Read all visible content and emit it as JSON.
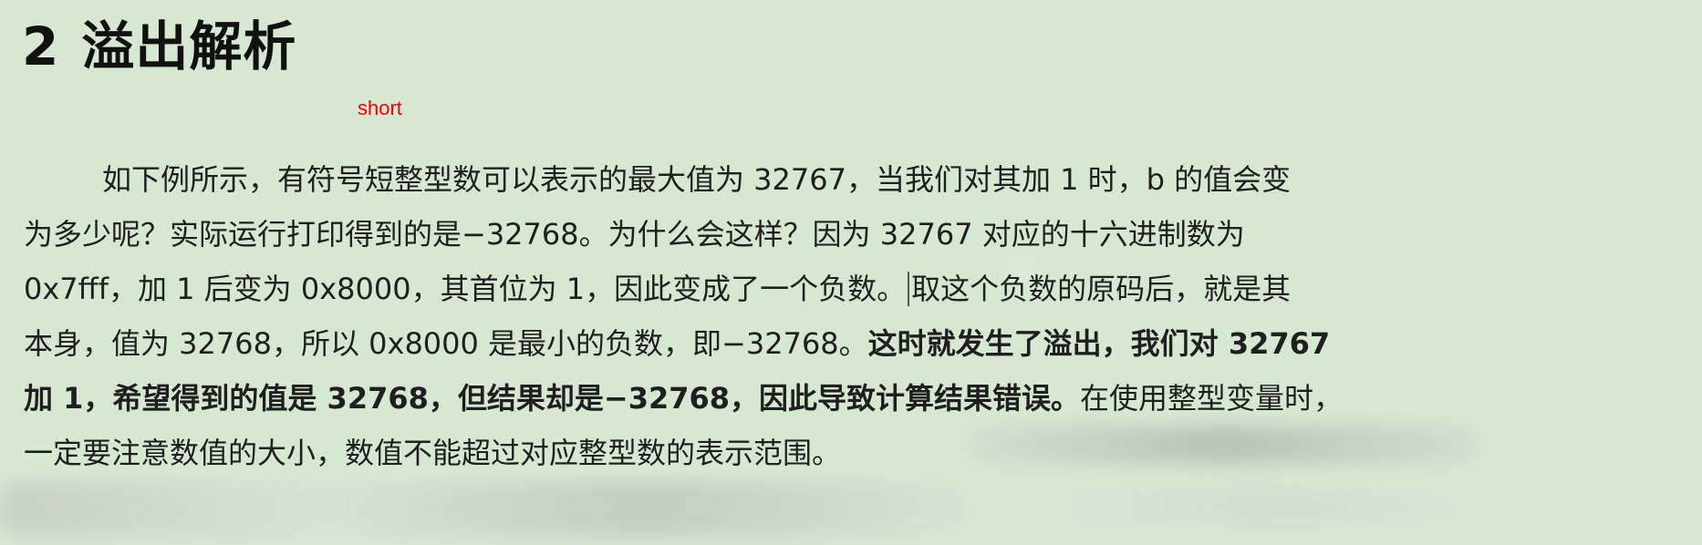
{
  "heading": {
    "number": "2",
    "title": "溢出解析"
  },
  "annotation": {
    "text": "short"
  },
  "paragraph": {
    "line1": "如下例所示，有符号短整型数可以表示的最大值为 32767，当我们对其加 1 时，b 的值会变",
    "line2": "为多少呢？实际运行打印得到的是−32768。为什么会这样？因为 32767 对应的十六进制数为",
    "line3_before_cursor": "0x7fff，加 1 后变为 0x8000，其首位为 1，因此变成了一个负数。",
    "line3_after_cursor": "取这个负数的原码后，就是其",
    "line4_normal": "本身，值为 32768，所以 0x8000 是最小的负数，即−32768。",
    "line4_bold": "这时就发生了溢出，我们对 32767",
    "line5_bold": "加 1，希望得到的值是 32768，但结果却是−32768，因此导致计算结果错误。",
    "line5_normal": "在使用整型变量时，",
    "line6": "一定要注意数值的大小，数值不能超过对应整型数的表示范围。"
  }
}
